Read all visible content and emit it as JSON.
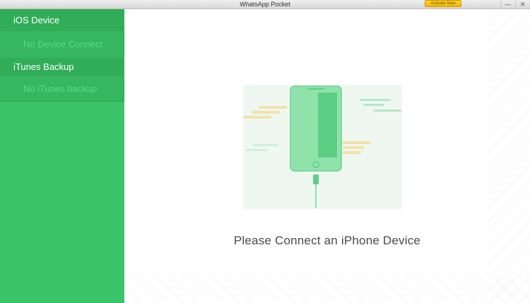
{
  "window": {
    "title": "WhatsApp Pocket",
    "activate_label": "Activate Now",
    "minimize_glyph": "—",
    "close_glyph": "✕"
  },
  "sidebar": {
    "ios": {
      "header": "iOS Device",
      "item": "No Device Connect"
    },
    "itunes": {
      "header": "iTunes Backup",
      "item": "No iTunes backup"
    }
  },
  "main": {
    "message": "Please Connect an iPhone Device",
    "illustration_icon": "iphone-connect-icon"
  },
  "colors": {
    "sidebar_green": "#3cc46a",
    "header_green": "#31ad5a",
    "phone_green": "#8be0a6",
    "dash_yellow": "#f2e0a6"
  }
}
